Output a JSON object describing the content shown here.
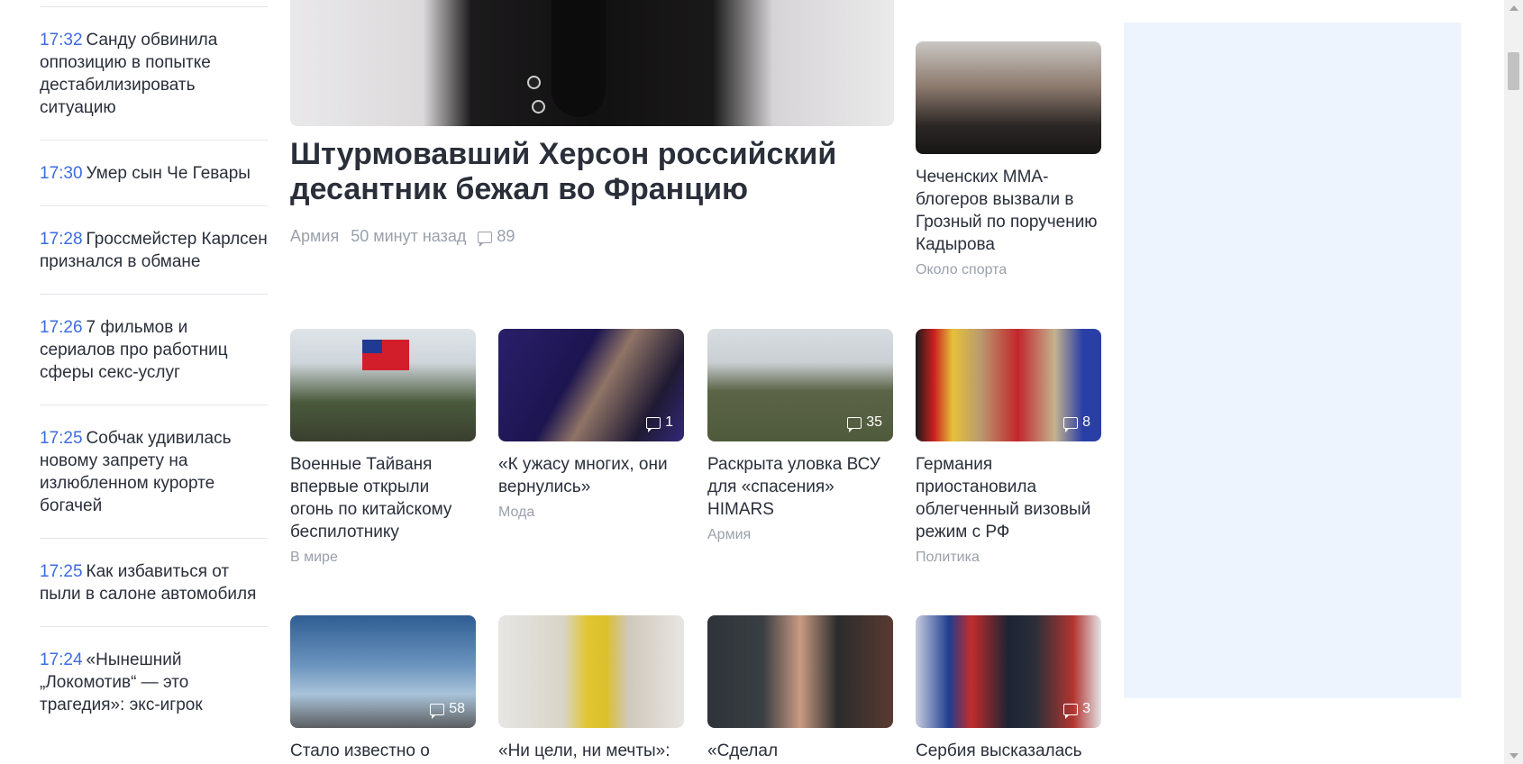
{
  "feed": [
    {
      "time": "17:32",
      "text": "Санду обвинила оппозицию в попытке дестабилизировать ситуацию"
    },
    {
      "time": "17:30",
      "text": "Умер сын Че Гевары"
    },
    {
      "time": "17:28",
      "text": "Гроссмейстер Карлсен признался в обмане"
    },
    {
      "time": "17:26",
      "text": "7 фильмов и сериалов про работниц сферы секс-услуг"
    },
    {
      "time": "17:25",
      "text": "Собчак удивилась новому запрету на излюбленном курорте богачей"
    },
    {
      "time": "17:25",
      "text": "Как избавиться от пыли в салоне автомобиля"
    },
    {
      "time": "17:24",
      "text": "«Нынешний „Локомотив“ — это трагедия»: экс-игрок"
    }
  ],
  "hero": {
    "title": "Штурмовавший Херсон российский десантник бежал во Францию",
    "category": "Армия",
    "time": "50 минут назад",
    "comments": "89"
  },
  "side_card": {
    "title": "Чеченских MMA-блогеров вызвали в Грозный по поручению Кадырова",
    "category": "Около спорта"
  },
  "grid_row1": [
    {
      "title": "Военные Тайваня впервые открыли огонь по китайскому беспилотнику",
      "category": "В мире",
      "comments": ""
    },
    {
      "title": "«К ужасу многих, они вернулись»",
      "category": "Мода",
      "comments": "1"
    },
    {
      "title": "Раскрыта уловка ВСУ для «спасения» HIMARS",
      "category": "Армия",
      "comments": "35"
    },
    {
      "title": "Германия приостановила облегченный визовый режим с РФ",
      "category": "Политика",
      "comments": "8"
    }
  ],
  "grid_row2": [
    {
      "title": "Стало известно о",
      "comments": "58"
    },
    {
      "title": "«Ни цели, ни мечты»:",
      "comments": ""
    },
    {
      "title": "«Сделал",
      "comments": ""
    },
    {
      "title": "Сербия высказалась",
      "comments": "3"
    }
  ]
}
